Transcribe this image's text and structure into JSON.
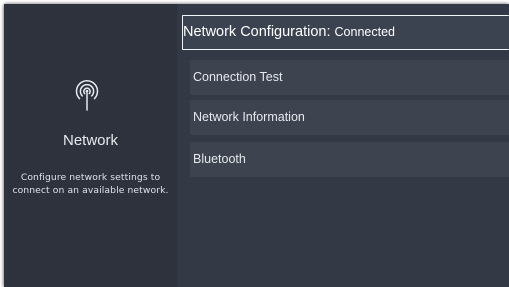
{
  "sidebar": {
    "icon": "wireless-network-icon",
    "title": "Network",
    "description": "Configure network settings to connect on an available network."
  },
  "menu": {
    "network_configuration": {
      "label": "Network Configuration:",
      "value": "Connected"
    },
    "items": [
      {
        "label": "Connection Test"
      },
      {
        "label": "Network Information"
      },
      {
        "label": "Bluetooth"
      }
    ]
  },
  "colors": {
    "background": "#2b303b",
    "left_pane": "#2d323d",
    "right_pane": "#343a45",
    "menu_item": "#3d4450",
    "selected_border": "#f2f4f7",
    "text": "#e6e8ec"
  }
}
